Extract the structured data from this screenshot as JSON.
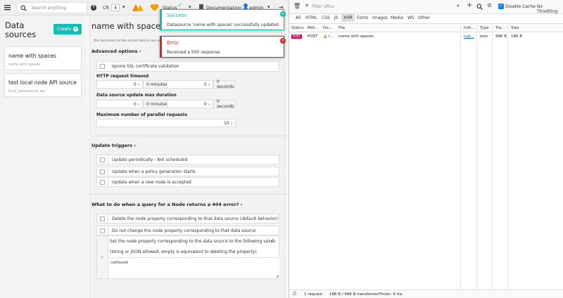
{
  "topbar": {
    "search_placeholder": "Search anything",
    "cr_label": "CR",
    "cr_value": "4",
    "status_label": "Status",
    "documentation_label": "Documentation",
    "user_label": "admin"
  },
  "sidebar": {
    "title_line1": "Data",
    "title_line2": "sources",
    "create_label": "Create",
    "items": [
      {
        "name": "name with spaces",
        "id": "name with spaces"
      },
      {
        "name": "test local node API source",
        "id": "local_datasource_api"
      }
    ]
  },
  "main": {
    "title": "name with spaces",
    "faded_text": "the document as the actual data to use as a",
    "advanced_options": "Advanced options",
    "ignore_ssl": "Ignore SSL certificate validation",
    "http_timeout_label": "HTTP request timeout",
    "timeout_minutes_value": "0",
    "timeout_minutes_unit": "0 minutes",
    "timeout_seconds_value": "0",
    "timeout_seconds_unit": "0 seconds",
    "max_duration_label": "Data source update max duration",
    "duration_minutes_value": "0",
    "duration_minutes_unit": "0 minutes",
    "duration_seconds_value": "0",
    "duration_seconds_unit": "0 seconds",
    "parallel_label": "Maximum number of parallel requests",
    "parallel_value": "10",
    "update_triggers": "Update triggers",
    "triggers": [
      "Update periodically - Not scheduled",
      "Update when a policy generation starts",
      "Update when a new node is accepted"
    ],
    "on_404_label": "What to do when a query for a Node returns a 404 error?",
    "on_404_options": [
      "Delete the node property corresponding to that data source (default behavior)",
      "Do not change the node property corresponding to that data source",
      "Set the node property corresponding to the data source to the following value:"
    ],
    "json_hint": "(string or JSON allowed, empty is equivalent to deleting the property)",
    "notfound_value": "notfound"
  },
  "toasts": {
    "success_title": "Success",
    "success_message": "Datasource 'name with spaces' successfully updated",
    "error_title": "Error",
    "error_message": "Received a 500 response"
  },
  "devtools": {
    "filter_placeholder": "Filter URLs",
    "disable_cache": "Disable Cache",
    "throttling": "No Throttling",
    "tabs": [
      "All",
      "HTML",
      "CSS",
      "JS",
      "XHR",
      "Fonts",
      "Images",
      "Media",
      "WS",
      "Other"
    ],
    "active_tab": "XHR",
    "columns": [
      "Status",
      "Met...",
      "Do...",
      "File",
      "Initi...",
      "Type",
      "Tra...",
      "Size"
    ],
    "row": {
      "status": "500",
      "method": "POST",
      "domain": "l...",
      "file": "name with spaces",
      "initiator": "rud...",
      "type": "json",
      "transferred": "996 B",
      "size": "186 B"
    },
    "footer": {
      "requests": "1 request",
      "transferred": "186 B / 996 B transferred",
      "finish": "Finish: 9 ms"
    }
  },
  "colors": {
    "teal": "#13beb7",
    "error_red": "#da291c",
    "status_500": "#e0005a"
  }
}
